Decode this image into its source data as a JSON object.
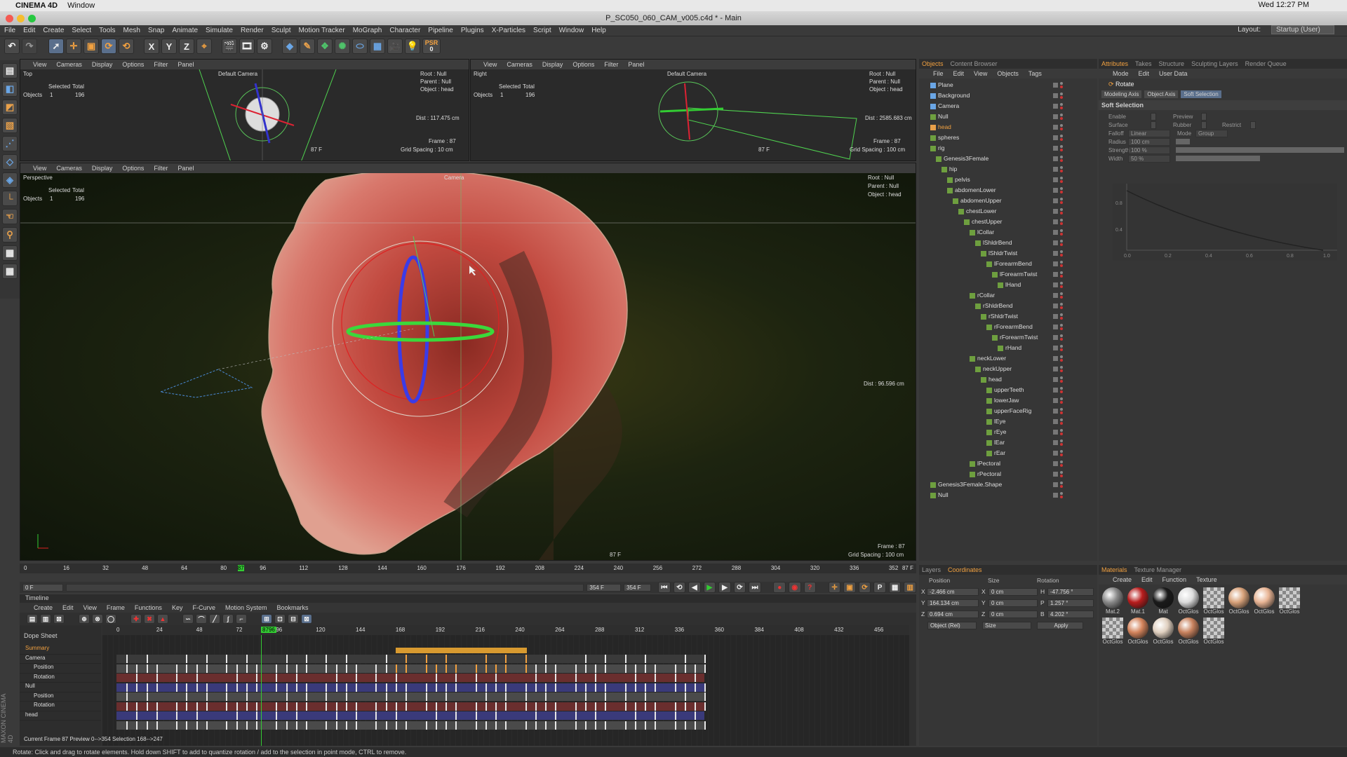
{
  "mac": {
    "app": "CINEMA 4D",
    "window": "Window",
    "clock": "Wed 12:27 PM"
  },
  "title": "P_SC050_060_CAM_v005.c4d * - Main",
  "menu": [
    "File",
    "Edit",
    "Create",
    "Select",
    "Tools",
    "Mesh",
    "Snap",
    "Animate",
    "Simulate",
    "Render",
    "Sculpt",
    "Motion Tracker",
    "MoGraph",
    "Character",
    "Pipeline",
    "Plugins",
    "X-Particles",
    "Script",
    "Window",
    "Help"
  ],
  "layout": {
    "label": "Layout:",
    "value": "Startup (User)"
  },
  "psr": {
    "label": "PSR",
    "value": "0"
  },
  "vp_menu": [
    "View",
    "Cameras",
    "Display",
    "Options",
    "Filter",
    "Panel"
  ],
  "top_vp": {
    "name": "Top",
    "camera": "Default Camera",
    "sel_hdr": [
      "Selected",
      "Total"
    ],
    "obj_label": "Objects",
    "obj_sel": "1",
    "obj_total": "196",
    "root": "Root : Null",
    "parent": "Parent : Null",
    "object": "Object : head",
    "dist": "Dist : 117.475 cm",
    "frame": "Frame : 87",
    "grid": "Grid Spacing : 10 cm",
    "f": "87 F"
  },
  "right_vp": {
    "name": "Right",
    "camera": "Default Camera",
    "sel_hdr": [
      "Selected",
      "Total"
    ],
    "obj_label": "Objects",
    "obj_sel": "1",
    "obj_total": "196",
    "root": "Root : Null",
    "parent": "Parent : Null",
    "object": "Object : head",
    "dist": "Dist : 2585.683 cm",
    "frame": "Frame : 87",
    "grid": "Grid Spacing : 100 cm",
    "f": "87 F"
  },
  "persp_vp": {
    "name": "Perspective",
    "camera": "Camera",
    "sel_hdr": [
      "Selected",
      "Total"
    ],
    "obj_label": "Objects",
    "obj_sel": "1",
    "obj_total": "196",
    "root": "Root : Null",
    "parent": "Parent : Null",
    "object": "Object : head",
    "dist": "Dist : 96.596 cm",
    "frame": "Frame : 87",
    "grid": "Grid Spacing : 100 cm",
    "f": "87 F"
  },
  "obj_tabs": [
    "Objects",
    "Content Browser"
  ],
  "obj_menu": [
    "File",
    "Edit",
    "View",
    "Objects",
    "Tags"
  ],
  "objects": [
    {
      "n": "Plane",
      "l": 0
    },
    {
      "n": "Background",
      "l": 0
    },
    {
      "n": "Camera",
      "l": 0
    },
    {
      "n": "Null",
      "l": 0
    },
    {
      "n": "head",
      "l": 0
    },
    {
      "n": "spheres",
      "l": 0
    },
    {
      "n": "rig",
      "l": 0
    },
    {
      "n": "Genesis3Female",
      "l": 1
    },
    {
      "n": "hip",
      "l": 2
    },
    {
      "n": "pelvis",
      "l": 3
    },
    {
      "n": "abdomenLower",
      "l": 3
    },
    {
      "n": "abdomenUpper",
      "l": 4
    },
    {
      "n": "chestLower",
      "l": 5
    },
    {
      "n": "chestUpper",
      "l": 6
    },
    {
      "n": "lCollar",
      "l": 7
    },
    {
      "n": "lShldrBend",
      "l": 8
    },
    {
      "n": "lShldrTwist",
      "l": 9
    },
    {
      "n": "lForearmBend",
      "l": 10
    },
    {
      "n": "lForearmTwist",
      "l": 11
    },
    {
      "n": "lHand",
      "l": 12
    },
    {
      "n": "rCollar",
      "l": 7
    },
    {
      "n": "rShldrBend",
      "l": 8
    },
    {
      "n": "rShldrTwist",
      "l": 9
    },
    {
      "n": "rForearmBend",
      "l": 10
    },
    {
      "n": "rForearmTwist",
      "l": 11
    },
    {
      "n": "rHand",
      "l": 12
    },
    {
      "n": "neckLower",
      "l": 7
    },
    {
      "n": "neckUpper",
      "l": 8
    },
    {
      "n": "head",
      "l": 9
    },
    {
      "n": "upperTeeth",
      "l": 10
    },
    {
      "n": "lowerJaw",
      "l": 10
    },
    {
      "n": "upperFaceRig",
      "l": 10
    },
    {
      "n": "lEye",
      "l": 10
    },
    {
      "n": "rEye",
      "l": 10
    },
    {
      "n": "lEar",
      "l": 10
    },
    {
      "n": "rEar",
      "l": 10
    },
    {
      "n": "lPectoral",
      "l": 7
    },
    {
      "n": "rPectoral",
      "l": 7
    },
    {
      "n": "Genesis3Female.Shape",
      "l": 0
    },
    {
      "n": "Null",
      "l": 0
    }
  ],
  "attr_tabs": [
    "Attributes",
    "Takes",
    "Structure",
    "Sculpting Layers",
    "Render Queue"
  ],
  "attr_menu": [
    "Mode",
    "Edit",
    "User Data"
  ],
  "attr_title": "Rotate",
  "attr_subtabs": [
    "Modeling Axis",
    "Object Axis",
    "Soft Selection"
  ],
  "soft": {
    "heading": "Soft Selection",
    "enable": "Enable",
    "preview": "Preview",
    "surface": "Surface",
    "rubber": "Rubber",
    "restrict": "Restrict",
    "falloff": "Falloff",
    "falloff_v": "Linear",
    "mode": "Mode",
    "mode_v": "Group",
    "radius": "Radius",
    "radius_v": "100 cm",
    "strength": "Strength",
    "strength_v": "100 %",
    "width": "Width",
    "width_v": "50 %",
    "graph_y": [
      "0.8",
      "0.4"
    ],
    "graph_x": [
      "0.0",
      "0.2",
      "0.4",
      "0.6",
      "0.8",
      "1.0"
    ]
  },
  "coord_tabs": [
    "Layers",
    "Coordinates"
  ],
  "coord": {
    "h1": "Position",
    "h2": "Size",
    "h3": "Rotation",
    "x": "-2.466 cm",
    "y": "164.134 cm",
    "z": "0.694 cm",
    "sx": "0 cm",
    "sy": "0 cm",
    "sz": "0 cm",
    "h": "-47.756 °",
    "p": "1.257 °",
    "b": "4.202 °",
    "mode1": "Object (Rel)",
    "mode2": "Size",
    "apply": "Apply"
  },
  "mat_tabs": [
    "Materials",
    "Texture Manager"
  ],
  "mat_menu": [
    "Create",
    "Edit",
    "Function",
    "Texture"
  ],
  "materials": [
    {
      "n": "Mat.2",
      "c": "#8a8a8a"
    },
    {
      "n": "Mat.1",
      "c": "#b81d1d"
    },
    {
      "n": "Mat",
      "c": "#1a1a1a"
    },
    {
      "n": "OctGlos",
      "c": "#dcdcdc"
    },
    {
      "n": "OctGlos",
      "c": "checker"
    },
    {
      "n": "OctGlos",
      "c": "#d8a27a"
    },
    {
      "n": "OctGlos",
      "c": "#e8b494"
    },
    {
      "n": "OctGlos",
      "c": "checker"
    },
    {
      "n": "OctGlos",
      "c": "checker"
    },
    {
      "n": "OctGlos",
      "c": "#d4845c"
    },
    {
      "n": "OctGlos",
      "c": "#e0d0c0"
    },
    {
      "n": "OctGlos",
      "c": "#c8825e"
    },
    {
      "n": "OctGlos",
      "c": "checker"
    }
  ],
  "ruler_ticks": [
    "0",
    "16",
    "32",
    "48",
    "64",
    "80",
    "87",
    "96",
    "112",
    "128",
    "144",
    "160",
    "176",
    "192",
    "208",
    "224",
    "240",
    "256",
    "272",
    "288",
    "304",
    "320",
    "336",
    "352"
  ],
  "ruler_end": "87 F",
  "transport": {
    "start": "0 F",
    "end": "354 F",
    "end2": "354 F"
  },
  "timeline": {
    "title": "Timeline",
    "menu": [
      "Create",
      "Edit",
      "View",
      "Frame",
      "Functions",
      "Key",
      "F-Curve",
      "Motion System",
      "Bookmarks"
    ],
    "mode": "Dope Sheet",
    "ticks": [
      "0",
      "24",
      "48",
      "72",
      "87",
      "96",
      "120",
      "144",
      "168",
      "192",
      "216",
      "240",
      "264",
      "288",
      "312",
      "336",
      "360",
      "384",
      "408",
      "432",
      "456"
    ],
    "cursor_label": "8796",
    "tracks": [
      "Summary",
      "Camera",
      "Position",
      "Rotation",
      "Null",
      "Position",
      "Rotation",
      "head"
    ],
    "status": "Current Frame  87  Preview  0-->354    Selection  168-->247"
  },
  "status": "Rotate: Click and drag to rotate elements. Hold down SHIFT to add to quantize rotation / add to the selection in point mode, CTRL to remove.",
  "maxon": "MAXON CINEMA 4D"
}
